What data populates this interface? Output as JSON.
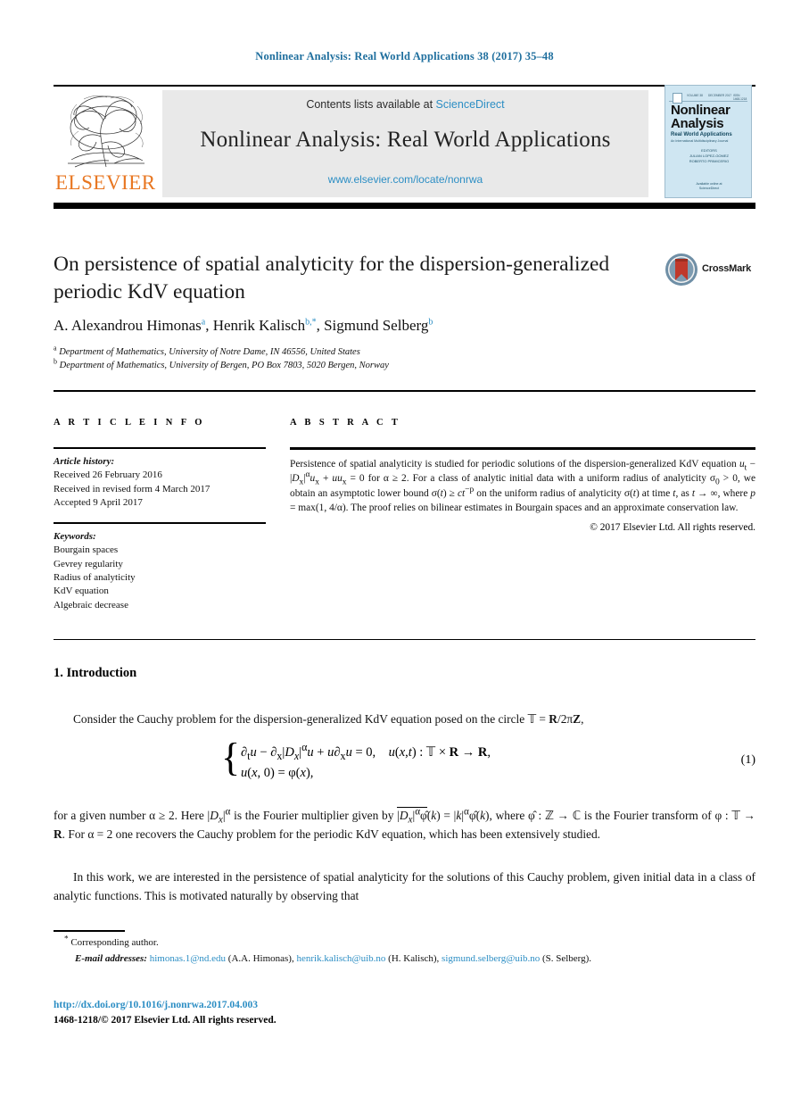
{
  "running_head": "Nonlinear Analysis: Real World Applications 38 (2017) 35–48",
  "masthead": {
    "contents_prefix": "Contents lists available at ",
    "sciencedirect": "ScienceDirect",
    "journal_title": "Nonlinear Analysis: Real World Applications",
    "journal_url": "www.elsevier.com/locate/nonrwa",
    "publisher": "ELSEVIER",
    "publisher_color": "#e87722",
    "link_color": "#2c8ec4",
    "cover": {
      "title_line1": "Nonlinear",
      "title_line2": "Analysis",
      "subtitle": "Real World Applications",
      "subtitle2": "An International Multidisciplinary Journal",
      "editors": "EDITORS\nJULIAN LOPEZ-GOMEZ\nROBERTO PRIMICERIO",
      "footer": "Available online at\nScienceDirect",
      "top_left": "VOLUME 38",
      "top_mid": "DECEMBER 2017",
      "top_right": "ISSN 1468-1218",
      "background": "#cfe6f2"
    }
  },
  "article": {
    "title": "On persistence of spatial analyticity for the dispersion-generalized periodic KdV equation",
    "crossmark_label": "CrossMark",
    "authors_html": "A. Alexandrou Himonas<sup>a</sup>, Henrik Kalisch<sup>b,*</sup>, Sigmund Selberg<sup>b</sup>",
    "affiliation_a": "Department of Mathematics, University of Notre Dame, IN 46556, United States",
    "affiliation_b": "Department of Mathematics, University of Bergen, PO Box 7803, 5020 Bergen, Norway"
  },
  "info": {
    "heading": "A R T I C L E   I N F O",
    "history_label": "Article history:",
    "history": [
      "Received 26 February 2016",
      "Received in revised form 4 March 2017",
      "Accepted 9 April 2017"
    ],
    "keywords_label": "Keywords:",
    "keywords": [
      "Bourgain spaces",
      "Gevrey regularity",
      "Radius of analyticity",
      "KdV equation",
      "Algebraic decrease"
    ]
  },
  "abstract": {
    "heading": "A B S T R A C T",
    "text_html": "Persistence of spatial analyticity is studied for periodic solutions of the dispersion-generalized KdV equation <span class=\"mi\">u</span><sub>t</sub> − |<span class=\"mi\">D</span><sub>x</sub>|<sup>α</sup><span class=\"mi\">u</span><sub>x</sub> + <span class=\"mi\">uu</span><sub>x</sub> = 0 for α ≥ 2. For a class of analytic initial data with a uniform radius of analyticity σ<sub>0</sub> &gt; 0, we obtain an asymptotic lower bound σ(<span class=\"mi\">t</span>) ≥ <span class=\"mi\">ct</span><sup>−p</sup> on the uniform radius of analyticity σ(<span class=\"mi\">t</span>) at time <span class=\"mi\">t</span>, as <span class=\"mi\">t</span> → ∞, where <span class=\"mi\">p</span> = max(1, 4/α). The proof relies on bilinear estimates in Bourgain spaces and an approximate conservation law.",
    "copyright": "© 2017 Elsevier Ltd. All rights reserved."
  },
  "body": {
    "section_number_title": "1. Introduction",
    "paragraph_1_html": "Consider the Cauchy problem for the dispersion-generalized KdV equation posed on the circle 𝕋 = <span class=\"bb\">R</span>/2π<span class=\"bb\">Z</span>,",
    "equation_line_1_html": "∂<sub>t</sub><span class=\"mi\">u</span> − ∂<sub>x</sub>|<span class=\"mi\">D<sub>x</sub></span>|<sup>α</sup><span class=\"mi\">u</span> + <span class=\"mi\">u</span>∂<sub>x</sub><span class=\"mi\">u</span> = 0,&nbsp;&nbsp;&nbsp; <span class=\"mi\">u</span>(<span class=\"mi\">x</span>,<span class=\"mi\">t</span>) : 𝕋 × <span class=\"bb\">R</span> → <span class=\"bb\">R</span>,",
    "equation_line_2_html": "<span class=\"mi\">u</span>(<span class=\"mi\">x</span>, 0) = φ(<span class=\"mi\">x</span>),",
    "equation_number": "(1)",
    "paragraph_2_html": "for a given number α ≥ 2. Here |<span class=\"mi\">D<sub>x</sub></span>|<sup>α</sup> is the Fourier multiplier given by <span style=\"border-top:1px solid #000;padding-top:1px;\">|<span class=\"mi\">D<sub>x</sub></span>|<sup>α</sup>φ̂</span>(<span class=\"mi\">k</span>) = |<span class=\"mi\">k</span>|<sup>α</sup>φ̂(<span class=\"mi\">k</span>), where φ̂ : ℤ → ℂ is the Fourier transform of φ : 𝕋 → <span class=\"bb\">R</span>. For α = 2 one recovers the Cauchy problem for the periodic KdV equation, which has been extensively studied.",
    "paragraph_3_html": "In this work, we are interested in the persistence of spatial analyticity for the solutions of this Cauchy problem, given initial data in a class of analytic functions. This is motivated naturally by observing that"
  },
  "footnotes": {
    "corresponding": "Corresponding author.",
    "email_label": "E-mail addresses:",
    "emails": [
      {
        "address": "himonas.1@nd.edu",
        "owner": "(A.A. Himonas)"
      },
      {
        "address": "henrik.kalisch@uib.no",
        "owner": "(H. Kalisch)"
      },
      {
        "address": "sigmund.selberg@uib.no",
        "owner": "(S. Selberg)."
      }
    ]
  },
  "footer": {
    "doi": "http://dx.doi.org/10.1016/j.nonrwa.2017.04.003",
    "issn_line": "1468-1218/© 2017 Elsevier Ltd. All rights reserved."
  }
}
